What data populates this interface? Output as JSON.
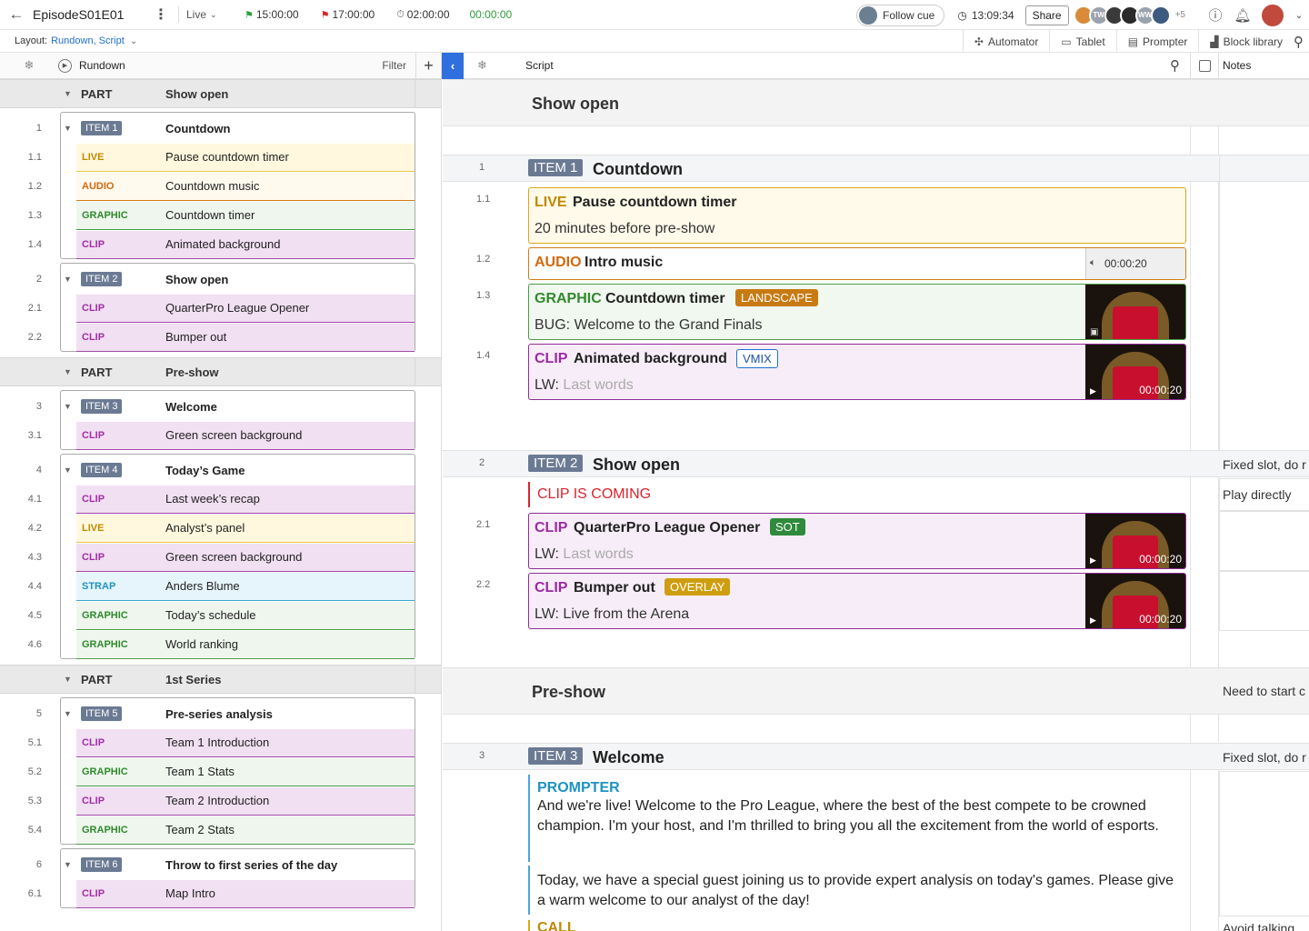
{
  "topbar": {
    "title": "EpisodeS01E01",
    "mode": "Live",
    "start_time": "15:00:00",
    "end_time": "17:00:00",
    "duration": "02:00:00",
    "elapsed": "00:00:00",
    "follow_cue": "Follow cue",
    "clock": "13:09:34",
    "share": "Share",
    "avatars": [
      "TW",
      "WW"
    ],
    "avatar_more": "+5"
  },
  "layoutbar": {
    "label": "Layout:",
    "value": "Rundown, Script",
    "automator": "Automator",
    "tablet": "Tablet",
    "prompter": "Prompter",
    "block_library": "Block library"
  },
  "rundown": {
    "title": "Rundown",
    "filter": "Filter"
  },
  "script_head": {
    "title": "Script",
    "notes": "Notes"
  },
  "left_parts": [
    {
      "label": "PART",
      "title": "Show open",
      "items": [
        {
          "num": "1",
          "badge": "ITEM 1",
          "title": "Countdown",
          "subs": [
            {
              "num": "1.1",
              "tag": "LIVE",
              "kind": "live",
              "label": "Pause countdown timer"
            },
            {
              "num": "1.2",
              "tag": "AUDIO",
              "kind": "audio",
              "label": "Countdown music"
            },
            {
              "num": "1.3",
              "tag": "GRAPHIC",
              "kind": "graphic",
              "label": "Countdown timer"
            },
            {
              "num": "1.4",
              "tag": "CLIP",
              "kind": "clip",
              "label": "Animated background"
            }
          ]
        },
        {
          "num": "2",
          "badge": "ITEM 2",
          "title": "Show open",
          "subs": [
            {
              "num": "2.1",
              "tag": "CLIP",
              "kind": "clip",
              "label": "QuarterPro League Opener"
            },
            {
              "num": "2.2",
              "tag": "CLIP",
              "kind": "clip",
              "label": "Bumper out"
            }
          ]
        }
      ]
    },
    {
      "label": "PART",
      "title": "Pre-show",
      "items": [
        {
          "num": "3",
          "badge": "ITEM 3",
          "title": "Welcome",
          "subs": [
            {
              "num": "3.1",
              "tag": "CLIP",
              "kind": "clip",
              "label": "Green screen background"
            }
          ]
        },
        {
          "num": "4",
          "badge": "ITEM 4",
          "title": "Today’s Game",
          "subs": [
            {
              "num": "4.1",
              "tag": "CLIP",
              "kind": "clip",
              "label": "Last week’s recap"
            },
            {
              "num": "4.2",
              "tag": "LIVE",
              "kind": "live",
              "label": "Analyst’s panel"
            },
            {
              "num": "4.3",
              "tag": "CLIP",
              "kind": "clip",
              "label": "Green screen background"
            },
            {
              "num": "4.4",
              "tag": "STRAP",
              "kind": "strap",
              "label": "Anders Blume"
            },
            {
              "num": "4.5",
              "tag": "GRAPHIC",
              "kind": "graphic",
              "label": "Today’s schedule"
            },
            {
              "num": "4.6",
              "tag": "GRAPHIC",
              "kind": "graphic",
              "label": "World ranking"
            }
          ]
        }
      ]
    },
    {
      "label": "PART",
      "title": "1st Series",
      "items": [
        {
          "num": "5",
          "badge": "ITEM 5",
          "title": "Pre-series analysis",
          "subs": [
            {
              "num": "5.1",
              "tag": "CLIP",
              "kind": "clip",
              "label": "Team 1 Introduction"
            },
            {
              "num": "5.2",
              "tag": "GRAPHIC",
              "kind": "graphic",
              "label": "Team 1 Stats"
            },
            {
              "num": "5.3",
              "tag": "CLIP",
              "kind": "clip",
              "label": "Team 2 Introduction"
            },
            {
              "num": "5.4",
              "tag": "GRAPHIC",
              "kind": "graphic",
              "label": "Team 2 Stats"
            }
          ]
        },
        {
          "num": "6",
          "badge": "ITEM 6",
          "title": "Throw to first series of the day",
          "subs": [
            {
              "num": "6.1",
              "tag": "CLIP",
              "kind": "clip",
              "label": "Map Intro"
            }
          ]
        }
      ]
    }
  ],
  "script": {
    "part1_title": "Show open",
    "item1": {
      "num": "1",
      "badge": "ITEM 1",
      "title": "Countdown"
    },
    "card11": {
      "num": "1.1",
      "tag": "LIVE",
      "title": "Pause countdown timer",
      "line": "20 minutes before pre-show"
    },
    "card12": {
      "num": "1.2",
      "tag": "AUDIO",
      "title": "Intro music",
      "duration": "00:00:20"
    },
    "card13": {
      "num": "1.3",
      "tag": "GRAPHIC",
      "title": "Countdown timer",
      "chip": "LANDSCAPE",
      "line_prefix": "BUG:",
      "line": "Welcome to the Grand Finals"
    },
    "card14": {
      "num": "1.4",
      "tag": "CLIP",
      "title": "Animated background",
      "chip": "VMIX",
      "line_prefix": "LW:",
      "line": "Last words",
      "duration": "00:00:20"
    },
    "item2": {
      "num": "2",
      "badge": "ITEM 2",
      "title": "Show open",
      "note": "Fixed slot, do r"
    },
    "cue": {
      "text": "CLIP IS COMING",
      "note": "Play directly"
    },
    "card21": {
      "num": "2.1",
      "tag": "CLIP",
      "title": "QuarterPro League Opener",
      "chip": "SOT",
      "line_prefix": "LW:",
      "line": "Last words",
      "duration": "00:00:20"
    },
    "card22": {
      "num": "2.2",
      "tag": "CLIP",
      "title": "Bumper out",
      "chip": "OVERLAY",
      "line_prefix": "LW:",
      "line": "Live from the Arena",
      "duration": "00:00:20"
    },
    "part2_title": "Pre-show",
    "part2_note": "Need to start c",
    "item3": {
      "num": "3",
      "badge": "ITEM 3",
      "title": "Welcome",
      "note": "Fixed slot, do r"
    },
    "prompter": {
      "tag": "PROMPTER",
      "p1": "And we're live! Welcome to the Pro League, where the best of the best compete to be crowned champion. I'm your host, and I'm thrilled to bring you all the excitement from the world of esports.",
      "p2": "Today, we have a special guest joining us to provide expert analysis on today's games. Please give a warm welcome to our analyst of the day!"
    },
    "call_tag": "CALL",
    "bottom_note": "Avoid talking"
  },
  "colors": {
    "accent": "#2f6fde",
    "live": "#c08a00",
    "audio": "#d2690e",
    "graphic": "#2f8a2c",
    "clip": "#a32ea8",
    "strap": "#1e93c4",
    "item_badge": "#6b7a93"
  }
}
